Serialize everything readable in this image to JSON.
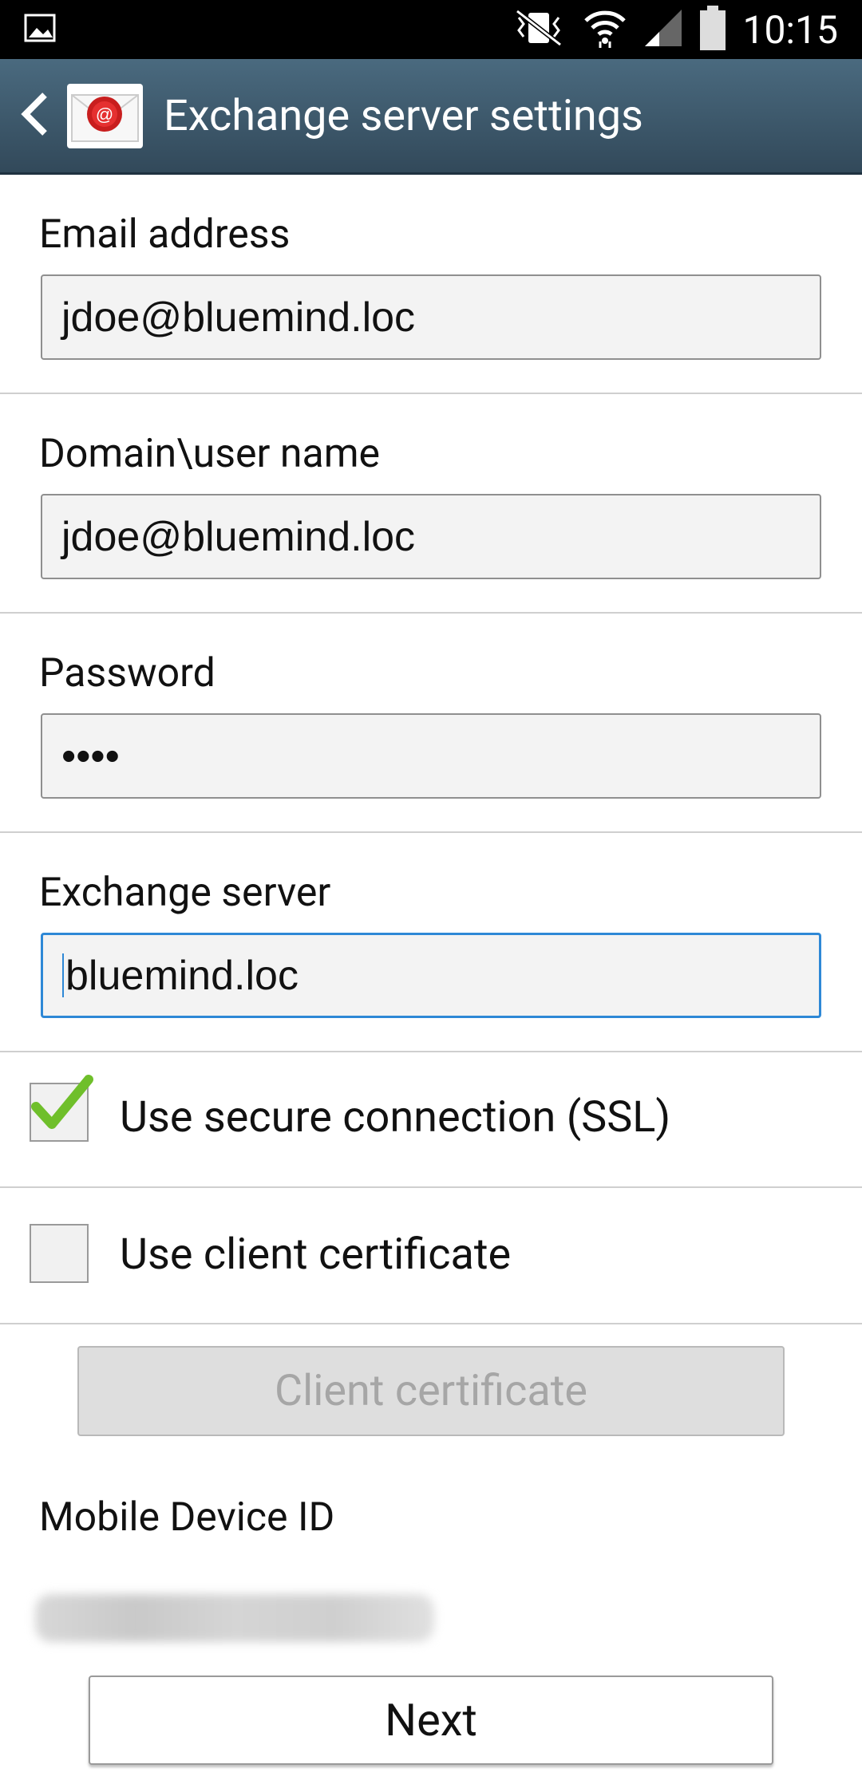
{
  "status_bar": {
    "time": "10:15"
  },
  "action_bar": {
    "title": "Exchange server settings"
  },
  "form": {
    "email": {
      "label": "Email address",
      "value": "jdoe@bluemind.loc"
    },
    "username": {
      "label": "Domain\\user name",
      "value": "jdoe@bluemind.loc"
    },
    "password": {
      "label": "Password",
      "value": "••••"
    },
    "server": {
      "label": "Exchange server",
      "value": "bluemind.loc"
    }
  },
  "options": {
    "ssl": {
      "label": "Use secure connection (SSL)",
      "checked": true
    },
    "client_cert": {
      "label": "Use client certificate",
      "checked": false
    }
  },
  "client_certificate_button": "Client certificate",
  "mobile_device_id_label": "Mobile Device ID",
  "next_button": "Next",
  "colors": {
    "accent": "#2e88d6",
    "checkmark": "#6fbf2b",
    "actionbar": "#3d5a6e"
  }
}
